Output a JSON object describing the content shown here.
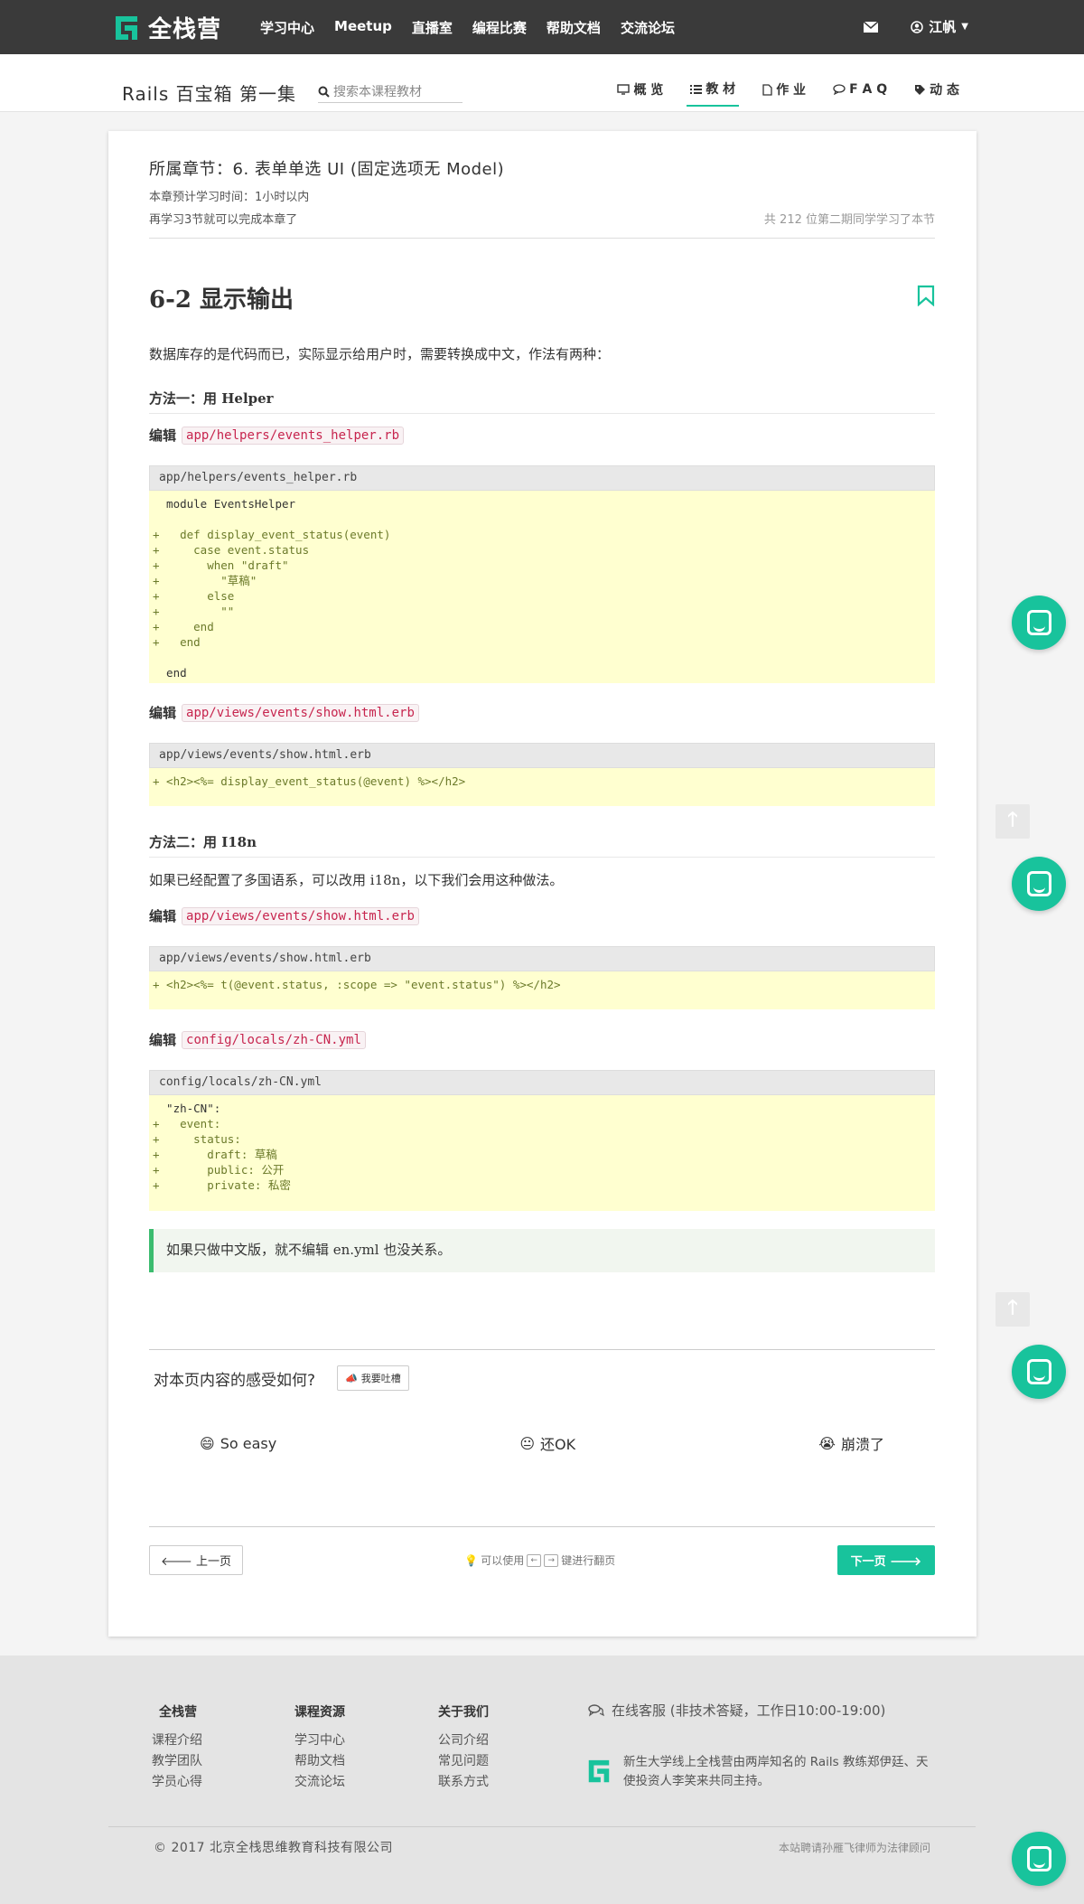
{
  "topbar": {
    "brand": "全栈营",
    "nav": [
      "学习中心",
      "Meetup",
      "直播室",
      "编程比赛",
      "帮助文档",
      "交流论坛"
    ],
    "user": "江帆"
  },
  "course": {
    "title": "Rails 百宝箱 第一集",
    "search_placeholder": "搜索本课程教材",
    "tabs": [
      {
        "label": "概 览",
        "icon": "monitor-icon"
      },
      {
        "label": "教 材",
        "icon": "list-icon"
      },
      {
        "label": "作 业",
        "icon": "file-icon"
      },
      {
        "label": "F A Q",
        "icon": "chat-icon"
      },
      {
        "label": "动 态",
        "icon": "tag-icon"
      }
    ],
    "active_tab": "教 材"
  },
  "lesson": {
    "chapter": "所属章节：6. 表单单选 UI (固定选项无 Model)",
    "est_time": "本章预计学习时间：1小时以内",
    "remaining": "再学习3节就可以完成本章了",
    "peers": "共 212 位第二期同学学习了本节",
    "title": "6-2 显示输出",
    "intro": "数据库存的是代码而已，实际显示给用户时，需要转换成中文，作法有两种：",
    "method1": "方法一：用 Helper",
    "method2": "方法二：用 I18n",
    "method2_desc": "如果已经配置了多国语系，可以改用 i18n，以下我们会用这种做法。",
    "edit_label": "编辑",
    "steps": [
      {
        "path": "app/helpers/events_helper.rb",
        "code": "  module EventsHelper\n\n+   def display_event_status(event)\n+     case event.status\n+       when \"draft\"\n+         \"草稿\"\n+       else\n+         \"\"\n+     end\n+   end\n\n  end"
      },
      {
        "path": "app/views/events/show.html.erb",
        "code": "+ <h2><%= display_event_status(@event) %></h2>"
      },
      {
        "path": "app/views/events/show.html.erb",
        "code": "+ <h2><%= t(@event.status, :scope => \"event.status\") %></h2>"
      },
      {
        "path": "config/locals/zh-CN.yml",
        "code": "  \"zh-CN\":\n+   event:\n+     status:\n+       draft: 草稿\n+       public: 公开\n+       private: 私密"
      }
    ],
    "tip": "如果只做中文版，就不编辑 en.yml 也没关系。"
  },
  "feedback": {
    "question": "对本页内容的感受如何?",
    "rant": "我要吐槽",
    "reactions": [
      "So easy",
      "还OK",
      "崩溃了"
    ]
  },
  "pager": {
    "prev": "上一页",
    "next": "下一页",
    "hint_pre": "可以使用",
    "hint_post": "键进行翻页",
    "key_left": "←",
    "key_right": "→"
  },
  "footer": {
    "col1": {
      "heading": "全栈营",
      "items": [
        "课程介绍",
        "教学团队",
        "学员心得"
      ]
    },
    "col2": {
      "heading": "课程资源",
      "items": [
        "学习中心",
        "帮助文档",
        "交流论坛"
      ]
    },
    "col3": {
      "heading": "关于我们",
      "items": [
        "公司介绍",
        "常见问题",
        "联系方式"
      ]
    },
    "service": "在线客服 (非技术答疑，工作日10:00-19:00)",
    "about": "新生大学线上全栈营由两岸知名的 Rails 教练郑伊廷、天使投资人李笑来共同主持。",
    "copyright": "© 2017 北京全栈思维教育科技有限公司",
    "legal": "本站聘请孙雁飞律师为法律顾问"
  },
  "colors": {
    "accent": "#18c39c",
    "topbar": "#3a3a3a",
    "code_bg": "#ffffd0",
    "chip_text": "#c7254e"
  }
}
